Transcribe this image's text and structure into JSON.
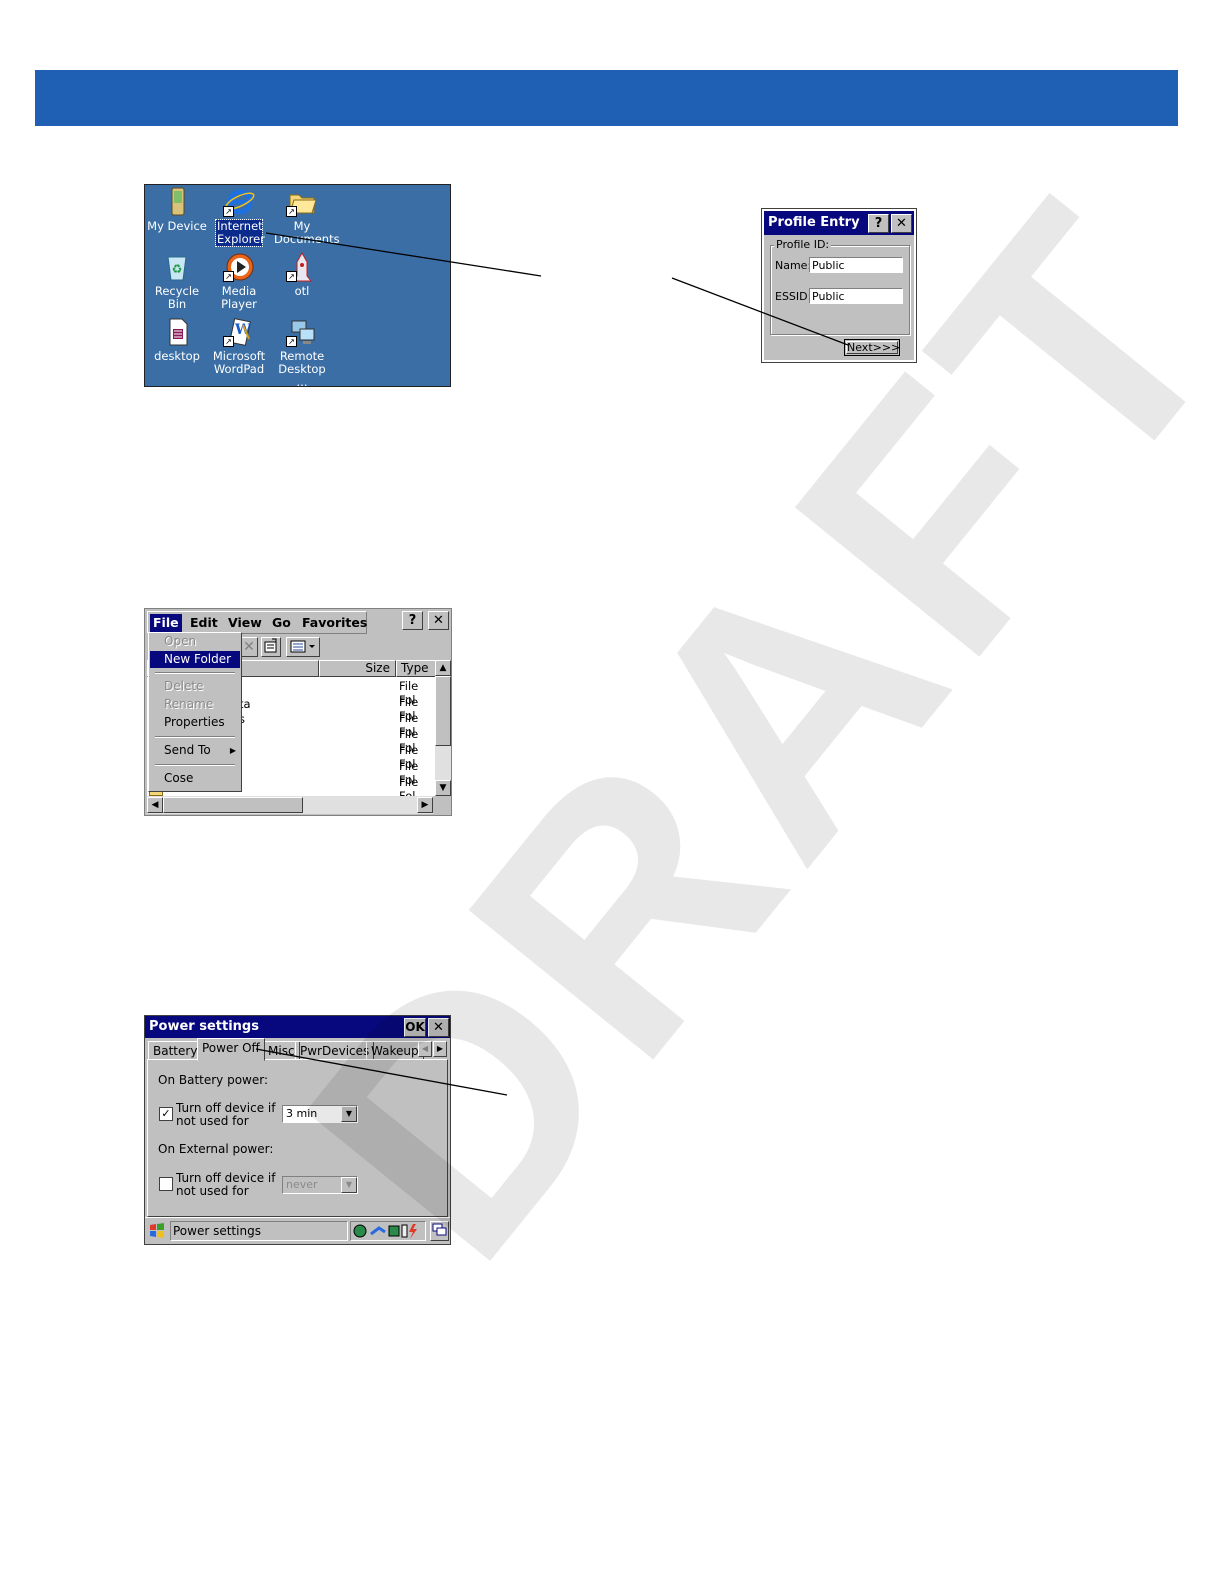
{
  "desktop": {
    "icons": [
      {
        "label": "My Device",
        "icon": "my-device-icon"
      },
      {
        "label": "Internet Explorer",
        "icon": "internet-explorer-icon"
      },
      {
        "label": "My Documents",
        "icon": "folder-icon"
      },
      {
        "label": "Recycle Bin",
        "icon": "recycle-bin-icon"
      },
      {
        "label": "Media Player",
        "icon": "media-player-icon"
      },
      {
        "label": "otl",
        "icon": "otl-icon"
      },
      {
        "label": "desktop",
        "icon": "desktop-file-icon"
      },
      {
        "label": "Microsoft WordPad",
        "icon": "wordpad-icon"
      },
      {
        "label": "Remote Desktop ...",
        "icon": "remote-desktop-icon"
      }
    ]
  },
  "profile": {
    "title": "Profile Entry",
    "help": "?",
    "close": "✕",
    "group": "Profile ID:",
    "name_label": "Name:",
    "name_value": "Public",
    "essid_label": "ESSID:",
    "essid_value": "Public",
    "next": "Next>>>"
  },
  "explorer": {
    "menu": [
      "File",
      "Edit",
      "View",
      "Go",
      "Favorites"
    ],
    "help": "?",
    "close": "✕",
    "file_menu": {
      "open": "Open",
      "new_folder": "New Folder",
      "delete": "Delete",
      "rename": "Rename",
      "properties": "Properties",
      "send_to": "Send To",
      "close": "Cose"
    },
    "columns": {
      "size": "Size",
      "type": "Type"
    },
    "partial_names": [
      "ta",
      "s"
    ],
    "rows": [
      "File Fol",
      "File Fol",
      "File Fol",
      "File Fol",
      "File Fol",
      "File Fol",
      "File Fol"
    ]
  },
  "power": {
    "title": "Power settings",
    "ok": "OK",
    "close": "✕",
    "tabs": [
      "Battery",
      "Power Off",
      "Misc",
      "PwrDevices",
      "Wakeup"
    ],
    "battery_heading": "On Battery power:",
    "battery_check_line1": "Turn off device if",
    "battery_check_line2": "not used for",
    "battery_value": "3 min",
    "battery_checked": true,
    "external_heading": "On External power:",
    "external_check_line1": "Turn off device if",
    "external_check_line2": "not used for",
    "external_value": "never",
    "external_checked": false,
    "taskbar_label": "Power settings"
  },
  "watermark": "DRAFT"
}
